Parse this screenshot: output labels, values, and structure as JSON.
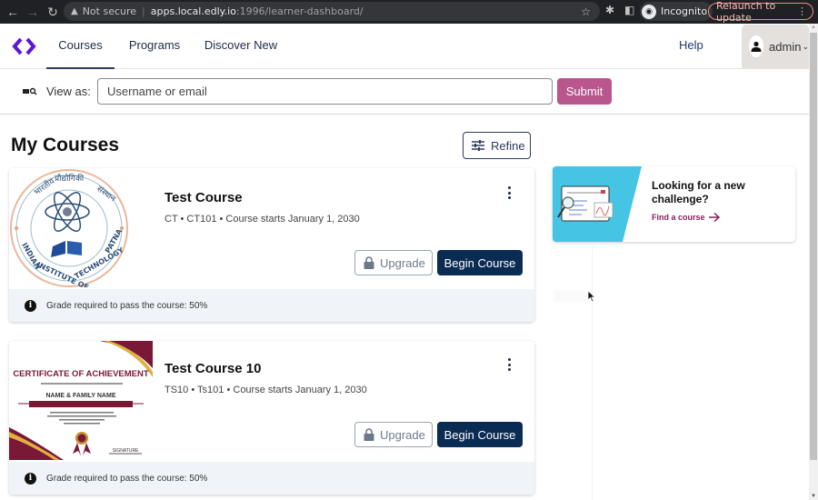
{
  "browser": {
    "url_warning": "Not secure",
    "url_host": "apps.local.edly.io",
    "url_path": ":1996/learner-dashboard/",
    "incognito_label": "Incognito",
    "relaunch_label": "Relaunch to update"
  },
  "header": {
    "nav": [
      {
        "label": "Courses",
        "active": true
      },
      {
        "label": "Programs",
        "active": false
      },
      {
        "label": "Discover New",
        "active": false
      }
    ],
    "help_label": "Help",
    "username": "admin",
    "brand_color": "#5b16d9"
  },
  "masquerade": {
    "label": "View as:",
    "input_value": "",
    "placeholder": "Username or email",
    "submit_label": "Submit"
  },
  "main": {
    "title": "My Courses",
    "refine_label": "Refine",
    "courses": [
      {
        "title": "Test Course",
        "meta": "CT • CT101 • Course starts January 1, 2030",
        "image": "Indian Institute of Technology Patna logo",
        "upgrade_label": "Upgrade",
        "begin_label": "Begin Course",
        "footer": "Grade required to pass the course: 50%"
      },
      {
        "title": "Test Course 10",
        "meta": "TS10 • Ts101 • Course starts January 1, 2030",
        "image": "Certificate of Achievement",
        "image_text": {
          "heading": "CERTIFICATE OF ACHIEVEMENT",
          "name": "NAME & FAMILY NAME",
          "signature": "SIGNATURE"
        },
        "upgrade_label": "Upgrade",
        "begin_label": "Begin Course",
        "footer": "Grade required to pass the course: 50%"
      }
    ]
  },
  "sidebar": {
    "promo_title": "Looking for a new challenge?",
    "promo_link": "Find a course"
  }
}
